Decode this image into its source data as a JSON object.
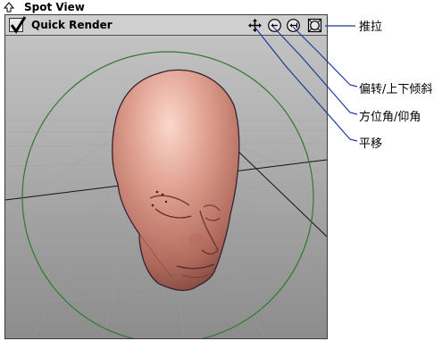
{
  "window": {
    "title": "Spot View"
  },
  "toolbar": {
    "quick_render_label": "Quick Render",
    "quick_render_checked": true
  },
  "icons": {
    "collapse": "triangle-up-icon",
    "pan": "move-arrows-icon",
    "azimuth_elevation": "rotate-circle-left-icon",
    "pan_tilt": "rotate-circle-right-icon",
    "dolly": "box-circle-icon"
  },
  "callouts": {
    "dolly": "推拉",
    "pan_tilt": "偏转/上下倾斜",
    "azimuth_elevation": "方位角/仰角",
    "pan": "平移"
  },
  "colors": {
    "callout_line": "#1a3a9a",
    "range_circle": "#2e7a2e",
    "floor_gradient_top": "#b8b8b8",
    "floor_gradient_bottom": "#8a8a8a",
    "head_skin": "#d89484"
  }
}
